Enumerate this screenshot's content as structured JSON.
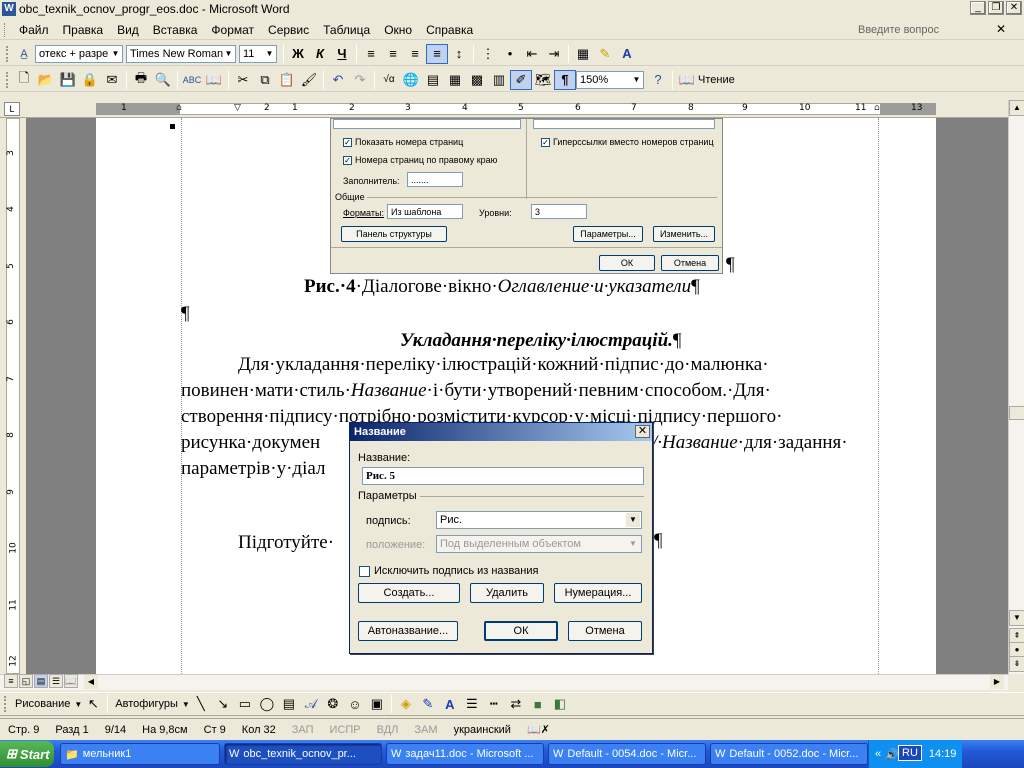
{
  "window": {
    "title": "obc_texnik_ocnov_progr_eos.doc - Microsoft Word"
  },
  "menu": {
    "items": [
      "Файл",
      "Правка",
      "Вид",
      "Вставка",
      "Формат",
      "Сервис",
      "Таблица",
      "Окно",
      "Справка"
    ],
    "help_placeholder": "Введите вопрос"
  },
  "formatting": {
    "style": "отекс + разре",
    "font": "Times New Roman",
    "size": "11",
    "bold": "Ж",
    "italic": "К",
    "underline": "Ч"
  },
  "standard": {
    "zoom": "150%",
    "read_label": "Чтение"
  },
  "ruler": {
    "h_numbers": [
      "1",
      "2",
      "1",
      "2",
      "3",
      "4",
      "5",
      "6",
      "7",
      "8",
      "9",
      "10",
      "11",
      "12",
      "13"
    ],
    "v_numbers": [
      "3",
      "4",
      "5",
      "6",
      "7",
      "8",
      "9",
      "10",
      "11",
      "12"
    ]
  },
  "toc_dialog": {
    "show_page_numbers": "Показать номера страниц",
    "right_align": "Номера страниц по правому краю",
    "hyperlinks": "Гиперссылки вместо номеров страниц",
    "filler_label": "Заполнитель:",
    "filler_value": ".......",
    "general_label": "Общие",
    "formats_label": "Форматы:",
    "formats_value": "Из шаблона",
    "levels_label": "Уровни:",
    "levels_value": "3",
    "outline_button": "Панель структуры",
    "params_button": "Параметры...",
    "change_button": "Изменить...",
    "ok_button": "ОК",
    "cancel_button": "Отмена"
  },
  "document": {
    "caption_bold": "Рис.·4",
    "caption_rest": "·Діалогове·вікно·",
    "caption_italic": "Оглавление·и·указатели",
    "pilcrow": "¶",
    "heading": "Укладання·переліку·ілюстрацій.",
    "line1": "Для·укладання·переліку·ілюстрацій·кожний·підпис·до·малюнка·",
    "line2_a": "повинен·мати·стиль·",
    "line2_italic": "Название",
    "line2_b": "·і·бути·утворений·певним·способом.·Для·",
    "line3": "створення·підпису·потрібно·розмістити·курсор·у·місці·підпису·першого·",
    "line4_a": "рисунка·докумен",
    "line4_italic": "/·Название",
    "line4_b": "·для·задання·",
    "line5": "параметрів·у·діал",
    "line6": "Підготуйте·"
  },
  "caption_dialog": {
    "title": "Название",
    "name_label": "Название:",
    "name_value": "Рис. 5",
    "params_label": "Параметры",
    "label_label": "подпись:",
    "label_value": "Рис.",
    "position_label": "положение:",
    "position_value": "Под выделенным объектом",
    "exclude_label": "Исключить подпись из названия",
    "create_button": "Создать...",
    "delete_button": "Удалить",
    "numbering_button": "Нумерация...",
    "autocaption_button": "Автоназвание...",
    "ok_button": "ОК",
    "cancel_button": "Отмена"
  },
  "drawing": {
    "draw_label": "Рисование",
    "autoshapes_label": "Автофигуры"
  },
  "status": {
    "page": "Стр. 9",
    "section": "Разд 1",
    "pages": "9/14",
    "at": "На 9,8см",
    "line": "Ст 9",
    "col": "Кол 32",
    "rec": "ЗАП",
    "trk": "ИСПР",
    "ext": "ВДЛ",
    "ovr": "ЗАМ",
    "lang": "украинский"
  },
  "taskbar": {
    "start": "Start",
    "tasks": [
      "мельник1",
      "obc_texnik_ocnov_pr...",
      "задач11.doc - Microsoft ...",
      "Default - 0054.doc - Micr...",
      "Default - 0052.doc - Micr..."
    ],
    "lang": "RU",
    "tray_lang": "Ru",
    "time": "14:19"
  }
}
